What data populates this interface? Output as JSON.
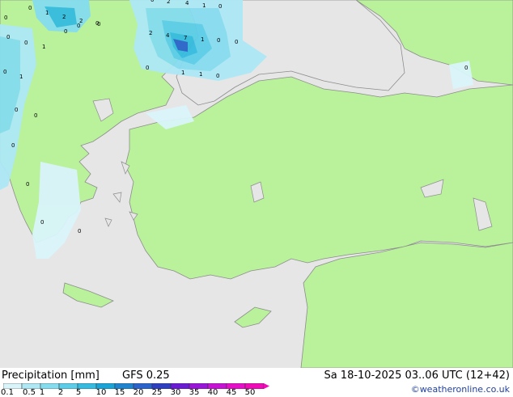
{
  "footer": {
    "title": "Precipitation [mm]",
    "model": "GFS 0.25",
    "datetime": "Sa 18-10-2025 03..06 UTC (12+42)",
    "credit": "©weatheronline.co.uk"
  },
  "colorbar": {
    "ticks": [
      "0.1",
      "0.5",
      "1",
      "2",
      "5",
      "10",
      "15",
      "20",
      "25",
      "30",
      "35",
      "40",
      "45",
      "50"
    ],
    "colors": [
      "#d9f4fb",
      "#aee8f5",
      "#86dcef",
      "#5ccde8",
      "#35bbe0",
      "#1aa3d6",
      "#1f84d0",
      "#2a63cb",
      "#2e3fc2",
      "#6a1bd4",
      "#9915d8",
      "#c612d4",
      "#e60fc9",
      "#f00ab8"
    ]
  },
  "colors": {
    "land": "#b9f29b",
    "sea": "#e6e6e6",
    "coast": "#8c8c8c"
  },
  "map_labels": [
    "0",
    "1",
    "2",
    "2",
    "0",
    "0",
    "2",
    "4",
    "1",
    "0",
    "2",
    "4",
    "7",
    "1",
    "0",
    "0",
    "0",
    "0",
    "1",
    "0",
    "1",
    "1",
    "0",
    "0",
    "0",
    "1",
    "0",
    "0",
    "0",
    "0",
    "0",
    "0",
    "0",
    "0",
    "0",
    "0"
  ]
}
